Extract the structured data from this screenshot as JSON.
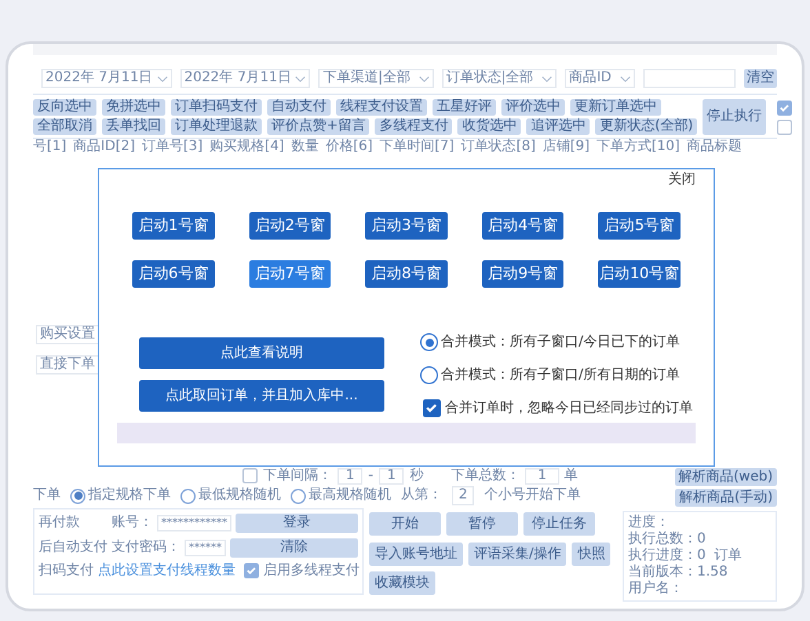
{
  "filters": {
    "date_from": "2022年 7月11日",
    "date_to": "2022年 7月11日",
    "selects": [
      "下单渠道|全部",
      "订单状态|全部",
      "商品ID"
    ],
    "clear_button": "清空"
  },
  "action_buttons": [
    [
      "反向选中",
      "免拼选中",
      "订单扫码支付",
      "自动支付",
      "线程支付设置",
      "五星好评",
      "评价选中",
      "更新订单选中"
    ],
    [
      "全部取消",
      "丢单找回",
      "订单处理退款",
      "评价点赞+留言",
      "多线程支付",
      "收货选中",
      "追评选中",
      "更新状态(全部)"
    ]
  ],
  "stop_button": "停止执行",
  "side_checks": [
    {
      "checked": true
    },
    {
      "checked": false
    }
  ],
  "table": {
    "columns": [
      "号[1]",
      "商品ID[2]",
      "订单号[3]",
      "购买规格[4]",
      "数量",
      "价格[6]",
      "下单时间[7]",
      "订单状态[8]",
      "店铺[9]",
      "下单方式[10]",
      "商品标题"
    ]
  },
  "left_panel": {
    "tab": "购买设置",
    "mode": "直接下单"
  },
  "interval": {
    "checked": false,
    "label": "下单间隔：",
    "from": "1",
    "dash": "-",
    "to": "1",
    "unit": "秒",
    "total_label": "下单总数：",
    "total": "1",
    "total_unit": "单"
  },
  "order_mode_cut_label": "下单",
  "order_modes": [
    {
      "label": "指定规格下单",
      "selected": true
    },
    {
      "label": "最低规格随机",
      "selected": false
    },
    {
      "label": "最高规格随机",
      "selected": false
    }
  ],
  "start_from": {
    "label": "从第：",
    "value": "2",
    "suffix": "个小号开始下单"
  },
  "payment": {
    "labels": [
      "再付款",
      "后自动支付",
      "扫码支付"
    ],
    "account_label": "账号：",
    "account": "************",
    "password_label": "支付密码：",
    "password": "******",
    "login_button": "登录",
    "clear_button": "清除",
    "link": "点此设置支付线程数量",
    "multithread": {
      "label": "启用多线程支付",
      "checked": true
    }
  },
  "control_buttons": [
    [
      "开始",
      "暂停",
      "停止任务"
    ],
    [
      "导入账号地址",
      "评语采集/操作",
      "快照",
      "收藏模块"
    ]
  ],
  "side_buttons": [
    "解析商品(web)",
    "解析商品(手动)"
  ],
  "status": {
    "progress_label": "进度：",
    "total": "执行总数：0",
    "progress": "执行进度：0",
    "orders": "订单",
    "version": "当前版本：1.58",
    "user": "用户名："
  },
  "dialog": {
    "close": "关闭",
    "windows": [
      {
        "label": "启动1号窗",
        "hovered": false
      },
      {
        "label": "启动2号窗",
        "hovered": false
      },
      {
        "label": "启动3号窗",
        "hovered": false
      },
      {
        "label": "启动4号窗",
        "hovered": false
      },
      {
        "label": "启动5号窗",
        "hovered": false
      },
      {
        "label": "启动6号窗",
        "hovered": false
      },
      {
        "label": "启动7号窗",
        "hovered": true
      },
      {
        "label": "启动8号窗",
        "hovered": false
      },
      {
        "label": "启动9号窗",
        "hovered": false
      },
      {
        "label": "启动10号窗",
        "hovered": false
      }
    ],
    "actions": [
      "点此查看说明",
      "点此取回订单，并且加入库中..."
    ],
    "merge_modes": [
      {
        "label": "合并模式：所有子窗口/今日已下的订单",
        "selected": true
      },
      {
        "label": "合并模式：所有子窗口/所有日期的订单",
        "selected": false
      }
    ],
    "ignore_synced": {
      "label": "合并订单时，忽略今日已经同步过的订单",
      "checked": true
    }
  }
}
